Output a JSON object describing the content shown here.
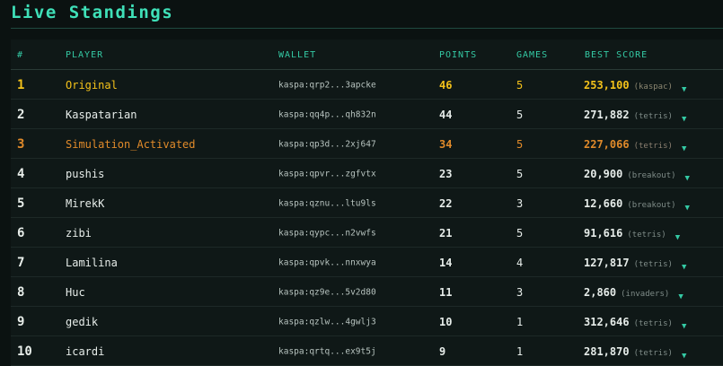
{
  "page": {
    "title": "Live Standings"
  },
  "table": {
    "headers": {
      "rank": "#",
      "player": "PLAYER",
      "wallet": "WALLET",
      "points": "POINTS",
      "games": "GAMES",
      "best_score": "BEST SCORE"
    },
    "rows": [
      {
        "rank": "1",
        "player": "Original",
        "wallet": "kaspa:qrp2...3apcke",
        "points": "46",
        "games": "5",
        "best": "253,100",
        "game": "(kaspac)",
        "tier": "gold"
      },
      {
        "rank": "2",
        "player": "Kaspatarian",
        "wallet": "kaspa:qq4p...qh832n",
        "points": "44",
        "games": "5",
        "best": "271,882",
        "game": "(tetris)",
        "tier": ""
      },
      {
        "rank": "3",
        "player": "Simulation_Activated",
        "wallet": "kaspa:qp3d...2xj647",
        "points": "34",
        "games": "5",
        "best": "227,066",
        "game": "(tetris)",
        "tier": "bronze"
      },
      {
        "rank": "4",
        "player": "pushis",
        "wallet": "kaspa:qpvr...zgfvtx",
        "points": "23",
        "games": "5",
        "best": "20,900",
        "game": "(breakout)",
        "tier": ""
      },
      {
        "rank": "5",
        "player": "MirekK",
        "wallet": "kaspa:qznu...ltu9ls",
        "points": "22",
        "games": "3",
        "best": "12,660",
        "game": "(breakout)",
        "tier": ""
      },
      {
        "rank": "6",
        "player": "zibi",
        "wallet": "kaspa:qypc...n2vwfs",
        "points": "21",
        "games": "5",
        "best": "91,616",
        "game": "(tetris)",
        "tier": ""
      },
      {
        "rank": "7",
        "player": "Lamilina",
        "wallet": "kaspa:qpvk...nnxwya",
        "points": "14",
        "games": "4",
        "best": "127,817",
        "game": "(tetris)",
        "tier": ""
      },
      {
        "rank": "8",
        "player": "Huc",
        "wallet": "kaspa:qz9e...5v2d80",
        "points": "11",
        "games": "3",
        "best": "2,860",
        "game": "(invaders)",
        "tier": ""
      },
      {
        "rank": "9",
        "player": "gedik",
        "wallet": "kaspa:qzlw...4gwlj3",
        "points": "10",
        "games": "1",
        "best": "312,646",
        "game": "(tetris)",
        "tier": ""
      },
      {
        "rank": "10",
        "player": "icardi",
        "wallet": "kaspa:qrtq...ex9t5j",
        "points": "9",
        "games": "1",
        "best": "281,870",
        "game": "(tetris)",
        "tier": ""
      }
    ],
    "expand_icon": "chevron-down-icon",
    "colors": {
      "accent": "#34c9a4",
      "gold": "#f4c21a",
      "bronze": "#e08a2a"
    }
  }
}
